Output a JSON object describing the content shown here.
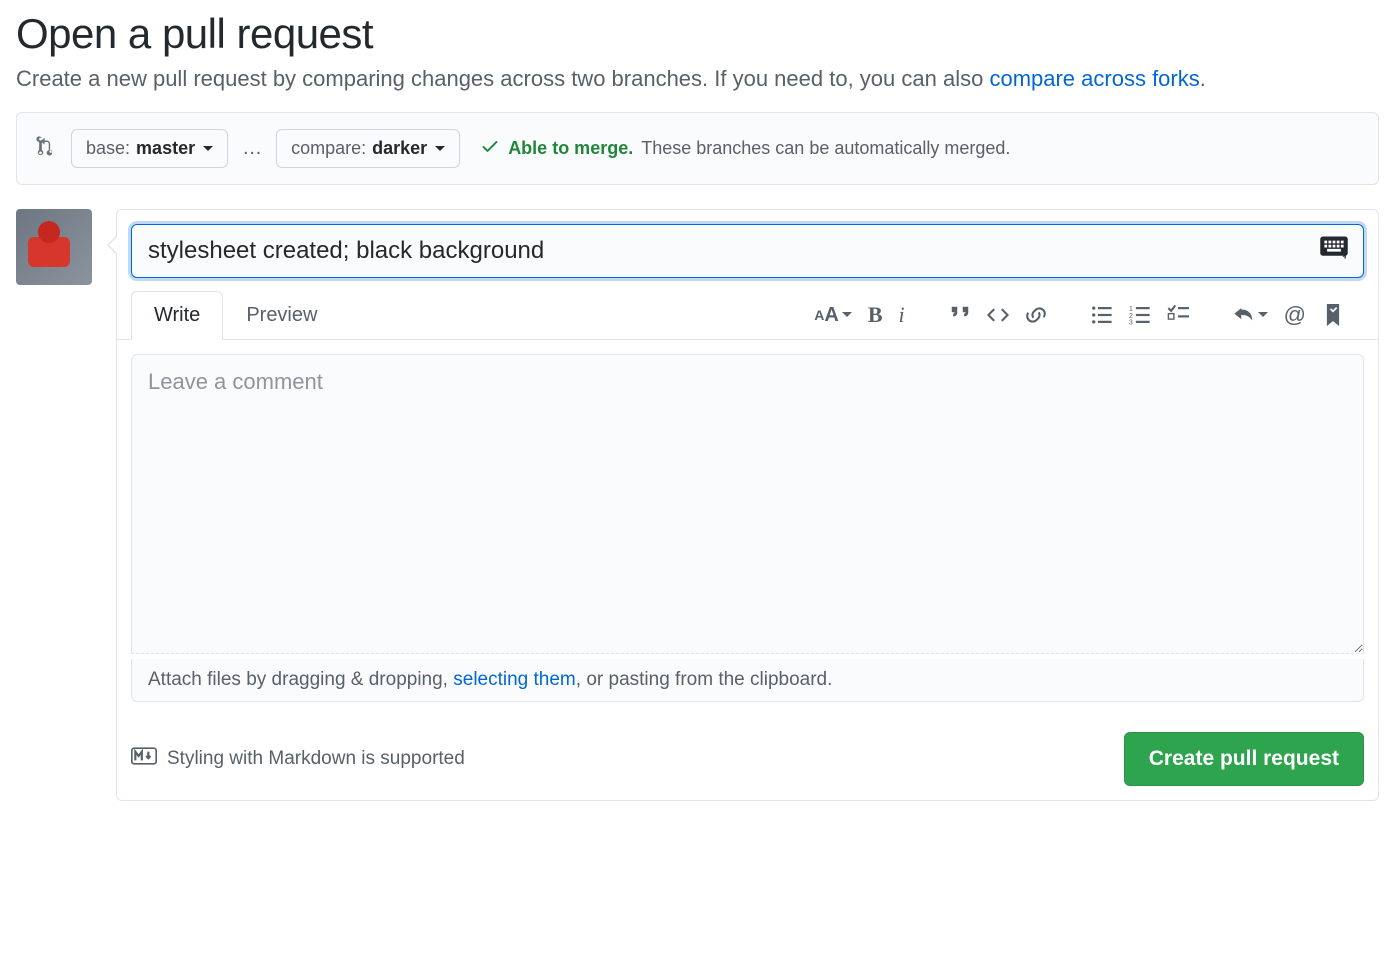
{
  "header": {
    "title": "Open a pull request",
    "subtitle_pre": "Create a new pull request by comparing changes across two branches. If you need to, you can also ",
    "subtitle_link": "compare across forks",
    "subtitle_post": "."
  },
  "range": {
    "base_label": "base: ",
    "base_branch": "master",
    "compare_label": "compare: ",
    "compare_branch": "darker",
    "status_strong": "Able to merge.",
    "status_rest": " These branches can be automatically merged."
  },
  "form": {
    "title_value": "stylesheet created; black background",
    "tab_write": "Write",
    "tab_preview": "Preview",
    "comment_placeholder": "Leave a comment",
    "attach_pre": "Attach files by dragging & dropping, ",
    "attach_link": "selecting them",
    "attach_post": ", or pasting from the clipboard.",
    "markdown_hint": "Styling with Markdown is supported",
    "submit_label": "Create pull request"
  }
}
